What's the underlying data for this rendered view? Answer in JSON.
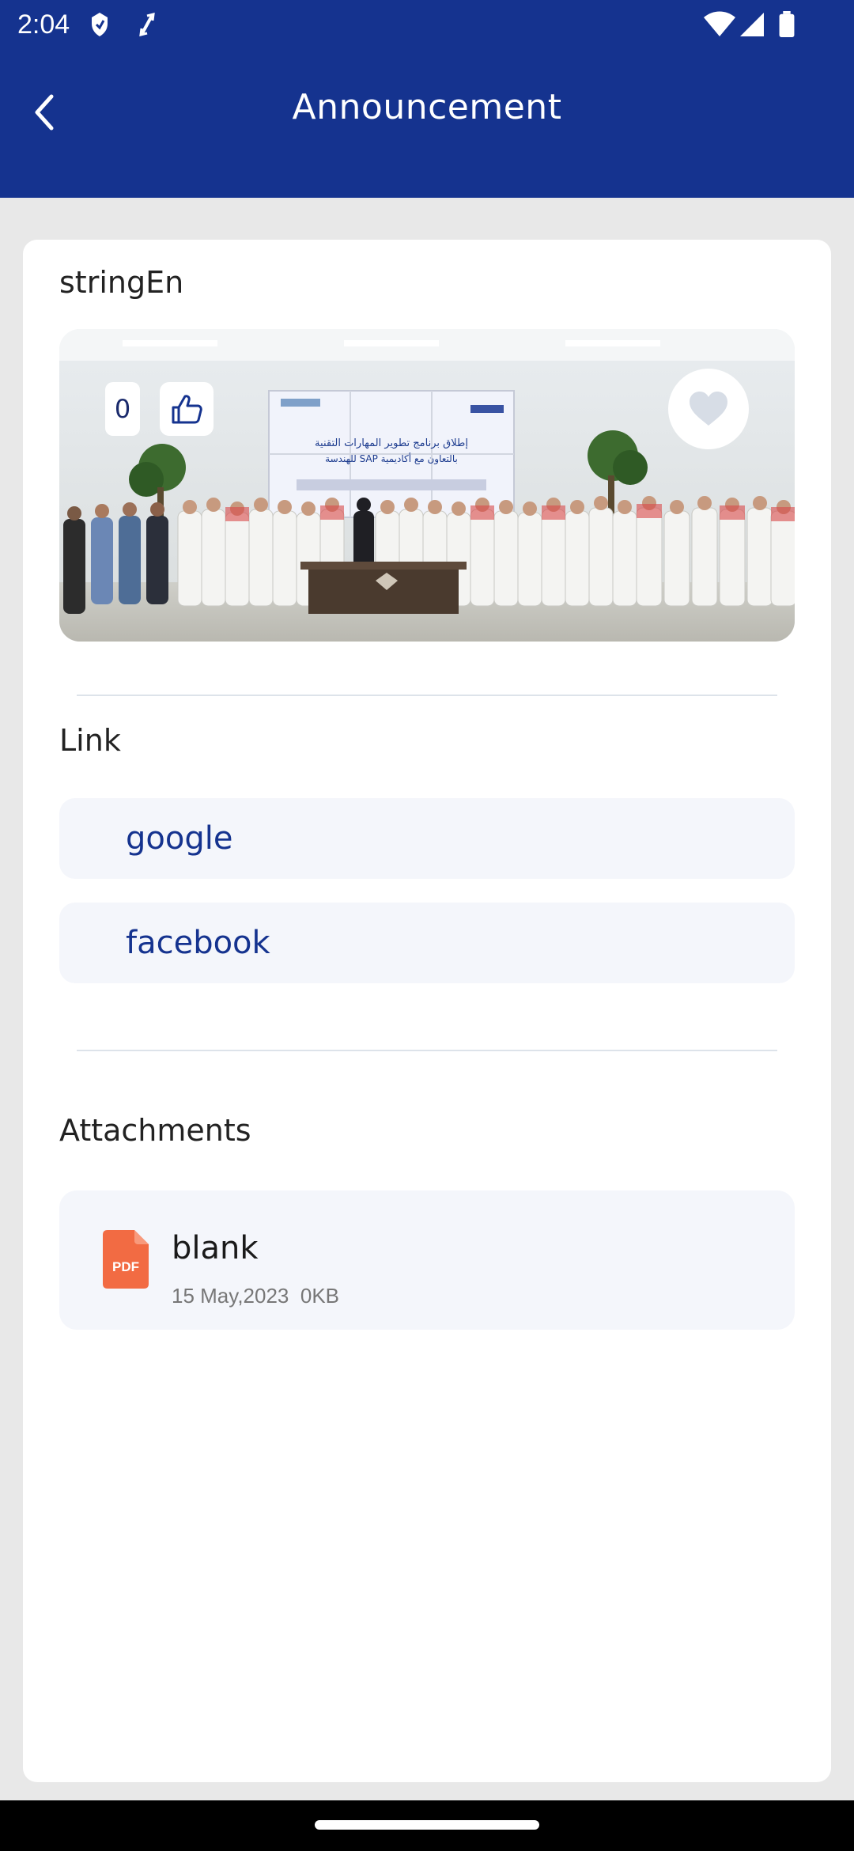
{
  "status_bar": {
    "time": "2:04"
  },
  "header": {
    "title": "Announcement"
  },
  "post": {
    "author": "stringEn",
    "like_count": "0",
    "photo_caption_line1": "إطلاق برنامج تطوير المهارات التقنية",
    "photo_caption_line2": "بالتعاون مع أكاديمية SAP للهندسة"
  },
  "links": {
    "heading": "Link",
    "items": [
      {
        "label": "google"
      },
      {
        "label": "facebook"
      }
    ]
  },
  "attachments": {
    "heading": "Attachments",
    "items": [
      {
        "name": "blank",
        "date": "15 May,2023",
        "size": "0KB",
        "type_label": "PDF"
      }
    ]
  },
  "colors": {
    "primary": "#15338f",
    "pdf": "#f26b43",
    "link_bg": "#f4f6fb"
  }
}
